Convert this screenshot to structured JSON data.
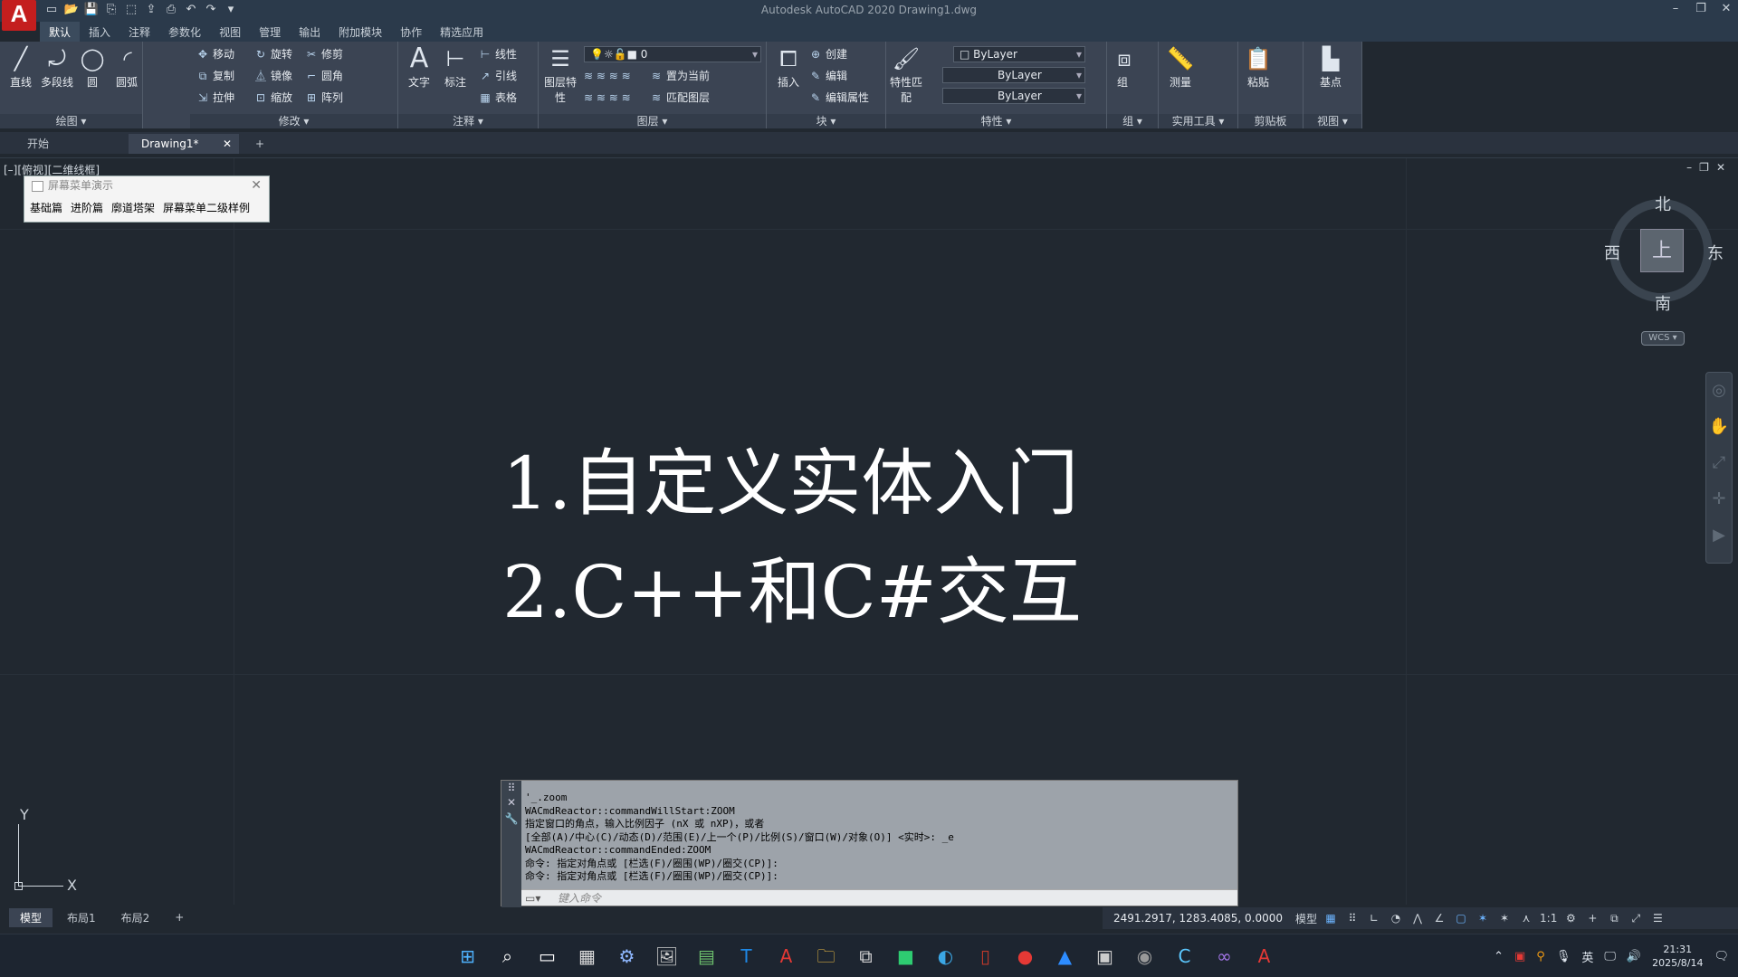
{
  "app": {
    "logo": "A",
    "title": "Autodesk AutoCAD 2020    Drawing1.dwg"
  },
  "menu_tabs": [
    "默认",
    "插入",
    "注释",
    "参数化",
    "视图",
    "管理",
    "输出",
    "附加模块",
    "协作",
    "精选应用"
  ],
  "ribbon": {
    "draw": {
      "title": "绘图 ▾",
      "line": "直线",
      "polyline": "多段线",
      "circle": "圆",
      "arc": "圆弧"
    },
    "modify": {
      "title": "修改 ▾",
      "move": "移动",
      "rotate": "旋转",
      "trim": "修剪",
      "copy": "复制",
      "mirror": "镜像",
      "fillet": "圆角",
      "stretch": "拉伸",
      "scale": "缩放",
      "array": "阵列"
    },
    "annotation": {
      "title": "注释 ▾",
      "text": "文字",
      "dimension": "标注",
      "linear": "线性",
      "leader": "引线",
      "table": "表格"
    },
    "layers": {
      "title": "图层 ▾",
      "props": "图层特性",
      "current_layer": "0",
      "set_current": "置为当前",
      "match_layer": "匹配图层"
    },
    "block": {
      "title": "块 ▾",
      "insert": "插入",
      "create": "创建",
      "edit": "编辑",
      "edit_attr": "编辑属性"
    },
    "properties": {
      "title": "特性 ▾",
      "match": "特性匹配",
      "color": "ByLayer",
      "linetype": "ByLayer",
      "lineweight": "ByLayer"
    },
    "groups": {
      "title": "组 ▾",
      "group": "组"
    },
    "utilities": {
      "title": "实用工具 ▾",
      "measure": "测量"
    },
    "clipboard": {
      "title": "剪贴板",
      "paste": "粘贴"
    },
    "view": {
      "title": "视图 ▾",
      "base": "基点"
    }
  },
  "doc_tabs": {
    "start": "开始",
    "drawing": "Drawing1*",
    "close": "✕",
    "add": "+"
  },
  "viewport": {
    "label": "[–][俯视][二维线框]",
    "controls": [
      "–",
      "❐",
      "✕"
    ]
  },
  "screen_menu": {
    "title": "屏幕菜单演示",
    "close": "✕",
    "items": [
      "基础篇",
      "进阶篇",
      "廓道塔架",
      "屏幕菜单二级样例"
    ]
  },
  "drawing_text": {
    "line1": "1.自定义实体入门",
    "line2": "2.C++和C#交互"
  },
  "viewcube": {
    "north": "北",
    "south": "南",
    "east": "东",
    "west": "西",
    "top": "上",
    "wcs": "WCS ▾"
  },
  "ucs": {
    "x": "X",
    "y": "Y"
  },
  "command": {
    "lines": [
      "'_.zoom",
      "WACmdReactor::commandWillStart:ZOOM",
      "指定窗口的角点，输入比例因子 (nX 或 nXP)，或者",
      "[全部(A)/中心(C)/动态(D)/范围(E)/上一个(P)/比例(S)/窗口(W)/对象(O)] <实时>: _e",
      "WACmdReactor::commandEnded:ZOOM",
      "命令: 指定对角点或 [栏选(F)/圈围(WP)/圈交(CP)]:",
      "命令: 指定对角点或 [栏选(F)/圈围(WP)/圈交(CP)]:"
    ],
    "placeholder": "键入命令"
  },
  "layout_tabs": [
    "模型",
    "布局1",
    "布局2",
    "+"
  ],
  "status": {
    "coords": "2491.2917, 1283.4085, 0.0000",
    "model": "模型",
    "scale": "1:1"
  },
  "tray": {
    "ime": "英",
    "time": "21:31",
    "date": "2025/8/14"
  }
}
